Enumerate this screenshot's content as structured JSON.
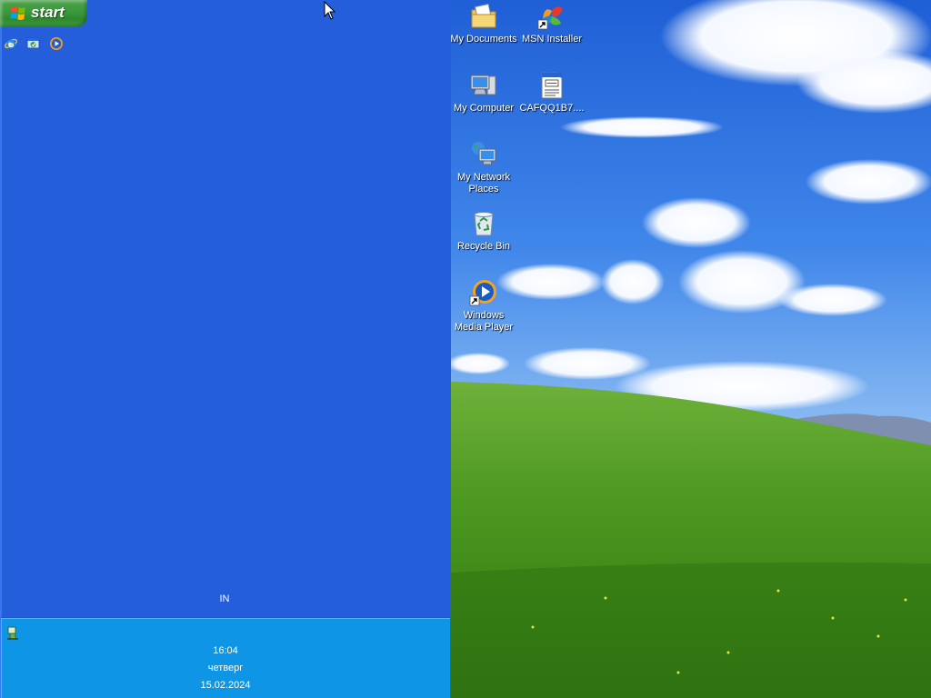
{
  "taskbar": {
    "start_label": "start",
    "quick_launch": [
      {
        "icon": "internet-explorer-icon"
      },
      {
        "icon": "show-desktop-icon"
      },
      {
        "icon": "windows-media-player-icon"
      }
    ],
    "language": "IN",
    "tray": {
      "icon": "network-connection-icon",
      "time": "16:04",
      "day": "четверг",
      "date": "15.02.2024"
    }
  },
  "desktop": {
    "wallpaper": "bliss",
    "icons": [
      {
        "label": "My Documents",
        "icon": "my-documents-icon"
      },
      {
        "label": "MSN Installer",
        "icon": "msn-installer-icon",
        "shortcut": true
      },
      {
        "label": "My Computer",
        "icon": "my-computer-icon"
      },
      {
        "label": "CAFQQ1B7....",
        "icon": "text-file-icon"
      },
      {
        "label": "My Network Places",
        "icon": "my-network-places-icon"
      },
      {
        "label": "Recycle Bin",
        "icon": "recycle-bin-icon"
      },
      {
        "label": "Windows Media Player",
        "icon": "windows-media-player-icon",
        "shortcut": true
      }
    ]
  },
  "colors": {
    "taskbar_blue": "#245edb",
    "tray_blue": "#0f95e6",
    "start_green": "#3c9a3c"
  }
}
